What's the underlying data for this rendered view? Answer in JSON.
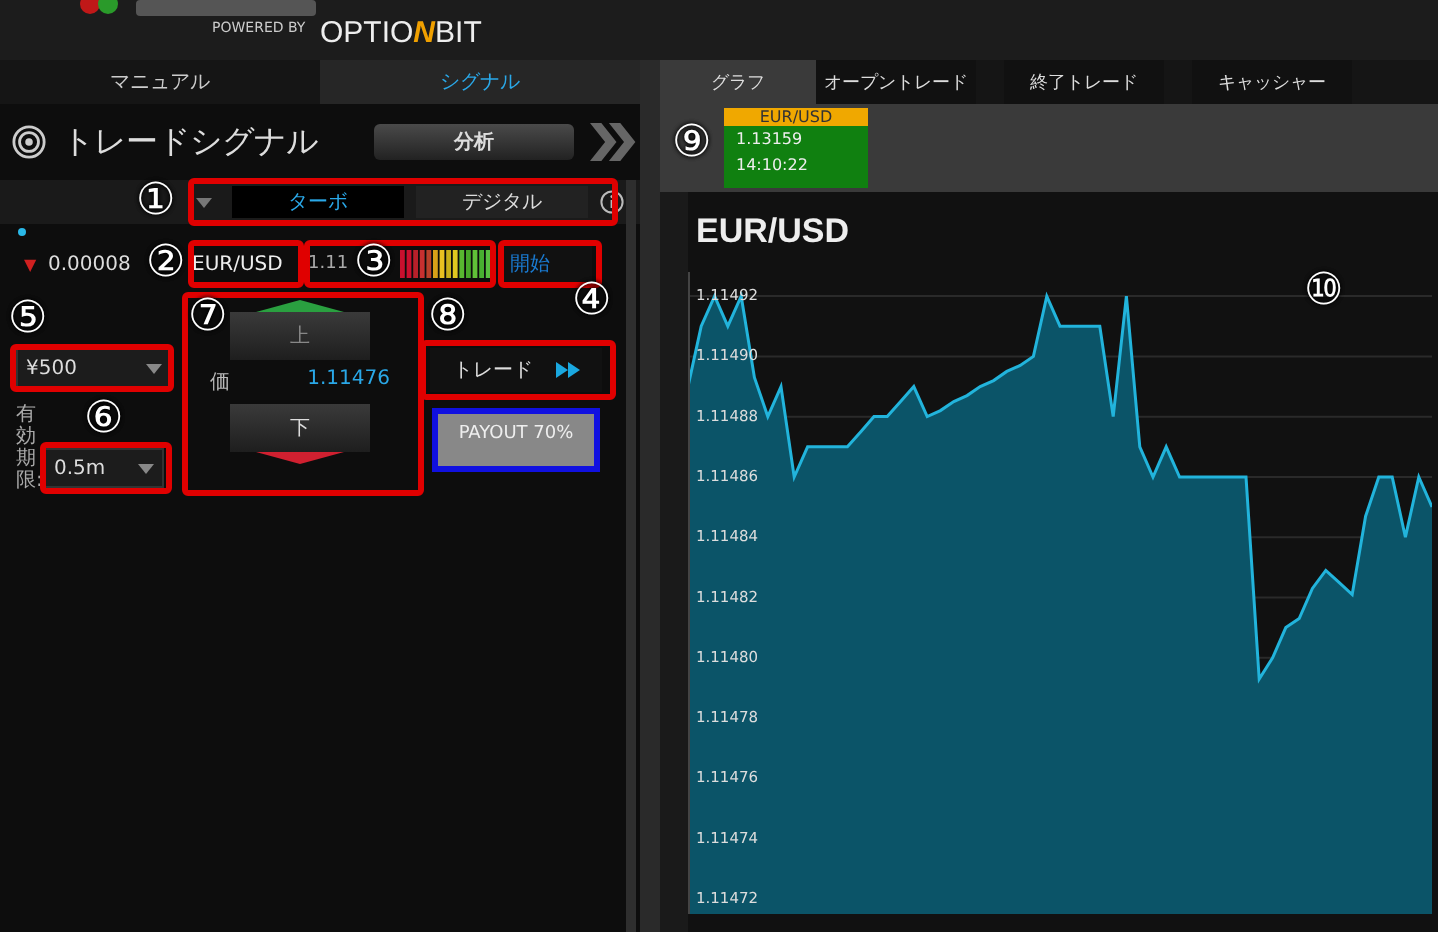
{
  "header": {
    "powered_by": "POWERED BY",
    "brand_parts": [
      "OPTIO",
      "N",
      "BIT"
    ]
  },
  "left_tabs": [
    {
      "label": "マニュアル",
      "selected": false
    },
    {
      "label": "シグナル",
      "selected": true
    }
  ],
  "right_tabs": [
    {
      "label": "グラフ",
      "selected": true
    },
    {
      "label": "オープントレード",
      "selected": false
    },
    {
      "label": "終了トレード",
      "selected": false
    },
    {
      "label": "キャッシャー",
      "selected": false
    }
  ],
  "signal_panel": {
    "title": "トレードシグナル",
    "analysis_button": "分析",
    "type_tabs": [
      {
        "label": "ターボ",
        "selected": true
      },
      {
        "label": "デジタル",
        "selected": false
      }
    ],
    "change_arrow": "▼",
    "change": "0.00008",
    "asset": "EUR/USD",
    "price_partial": "1.11",
    "start_button": "開始",
    "amount": "¥500",
    "expiry_label": "有効期限:",
    "expiry": "0.5m",
    "up_button": "上",
    "price_label": "価",
    "price": "1.11476",
    "down_button": "下",
    "trade_button": "トレード",
    "payout": "PAYOUT 70%"
  },
  "ticker": {
    "pair": "EUR/USD",
    "price": "1.13159",
    "time": "14:10:22"
  },
  "chart_data": {
    "type": "area",
    "title": "EUR/USD",
    "categories": [
      null,
      null,
      null,
      null,
      null,
      null,
      null,
      null,
      null,
      null,
      null,
      null,
      null,
      null,
      null,
      null,
      null,
      null,
      null,
      null,
      null,
      null,
      null,
      null,
      null,
      null,
      null,
      null,
      null,
      null,
      null,
      null,
      null,
      null,
      null,
      null,
      null,
      null,
      null,
      null,
      null,
      null,
      null,
      null,
      null,
      null,
      null,
      null,
      null,
      null,
      null,
      null,
      null,
      null,
      null,
      null,
      null
    ],
    "series": [
      {
        "color": "#22b4dc",
        "values": [
          1.11489,
          1.11491,
          1.11492,
          1.11491,
          1.11492,
          1.114893,
          1.11488,
          1.11489,
          1.11486,
          1.11487,
          1.11487,
          1.11487,
          1.11487,
          1.114875,
          1.11488,
          1.11488,
          1.114885,
          1.11489,
          1.11488,
          1.114882,
          1.114885,
          1.114887,
          1.11489,
          1.114892,
          1.114895,
          1.114897,
          1.1149,
          1.11492,
          1.11491,
          1.11491,
          1.11491,
          1.11491,
          1.11488,
          1.11492,
          1.11487,
          1.11486,
          1.11487,
          1.11486,
          1.11486,
          1.11486,
          1.11486,
          1.11486,
          1.11486,
          1.114793,
          1.1148,
          1.11481,
          1.114813,
          1.114823,
          1.114829,
          1.114825,
          1.114821,
          1.114847,
          1.11486,
          1.11486,
          1.11484,
          1.11486,
          1.11485
        ]
      }
    ],
    "ylim": [
      1.114715,
      1.114928
    ],
    "grid": true,
    "yticks": [
      {
        "value": 1.11492,
        "label": "1.11492"
      },
      {
        "value": 1.1149,
        "label": "1.11490"
      },
      {
        "value": 1.11488,
        "label": "1.11488"
      },
      {
        "value": 1.11486,
        "label": "1.11486"
      },
      {
        "value": 1.11484,
        "label": "1.11484"
      },
      {
        "value": 1.11482,
        "label": "1.11482"
      },
      {
        "value": 1.1148,
        "label": "1.11480"
      },
      {
        "value": 1.11478,
        "label": "1.11478"
      },
      {
        "value": 1.11476,
        "label": "1.11476"
      },
      {
        "value": 1.11474,
        "label": "1.11474"
      },
      {
        "value": 1.11472,
        "label": "1.11472"
      }
    ]
  },
  "annotations": [
    {
      "label": "①"
    },
    {
      "label": "②"
    },
    {
      "label": "③"
    },
    {
      "label": "④"
    },
    {
      "label": "⑤"
    },
    {
      "label": "⑥"
    },
    {
      "label": "⑦"
    },
    {
      "label": "⑧"
    },
    {
      "label": "⑨"
    },
    {
      "label": "⑩"
    }
  ]
}
